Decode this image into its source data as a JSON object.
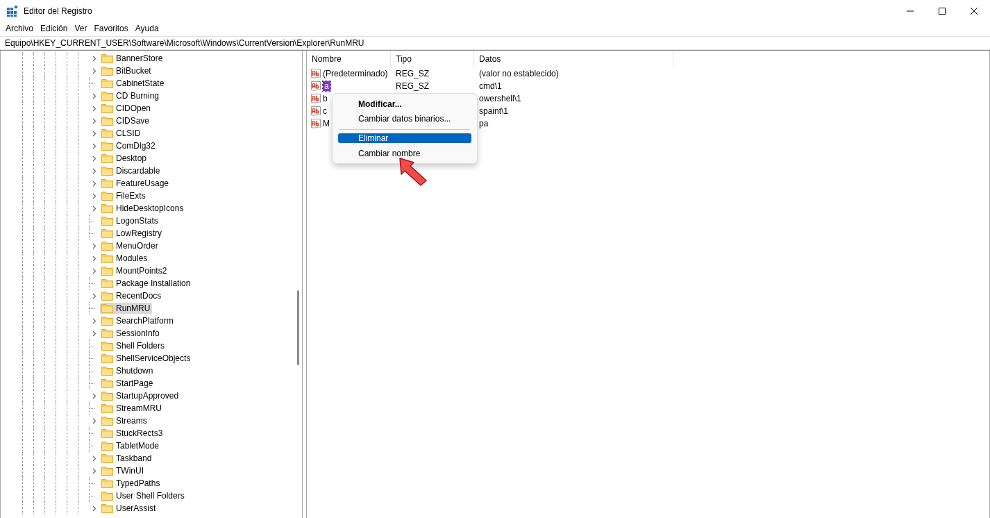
{
  "window": {
    "title": "Editor del Registro"
  },
  "menu": [
    "Archivo",
    "Edición",
    "Ver",
    "Favoritos",
    "Ayuda"
  ],
  "address": "Equipo\\HKEY_CURRENT_USER\\Software\\Microsoft\\Windows\\CurrentVersion\\Explorer\\RunMRU",
  "tree": [
    {
      "label": "BannerStore",
      "expandable": true,
      "selected": false
    },
    {
      "label": "BitBucket",
      "expandable": true,
      "selected": false
    },
    {
      "label": "CabinetState",
      "expandable": false,
      "selected": false
    },
    {
      "label": "CD Burning",
      "expandable": true,
      "selected": false
    },
    {
      "label": "CIDOpen",
      "expandable": true,
      "selected": false
    },
    {
      "label": "CIDSave",
      "expandable": true,
      "selected": false
    },
    {
      "label": "CLSID",
      "expandable": true,
      "selected": false
    },
    {
      "label": "ComDlg32",
      "expandable": true,
      "selected": false
    },
    {
      "label": "Desktop",
      "expandable": true,
      "selected": false
    },
    {
      "label": "Discardable",
      "expandable": true,
      "selected": false
    },
    {
      "label": "FeatureUsage",
      "expandable": true,
      "selected": false
    },
    {
      "label": "FileExts",
      "expandable": true,
      "selected": false
    },
    {
      "label": "HideDesktopIcons",
      "expandable": true,
      "selected": false
    },
    {
      "label": "LogonStats",
      "expandable": false,
      "selected": false
    },
    {
      "label": "LowRegistry",
      "expandable": false,
      "selected": false
    },
    {
      "label": "MenuOrder",
      "expandable": true,
      "selected": false
    },
    {
      "label": "Modules",
      "expandable": true,
      "selected": false
    },
    {
      "label": "MountPoints2",
      "expandable": true,
      "selected": false
    },
    {
      "label": "Package Installation",
      "expandable": false,
      "selected": false
    },
    {
      "label": "RecentDocs",
      "expandable": true,
      "selected": false
    },
    {
      "label": "RunMRU",
      "expandable": false,
      "selected": true
    },
    {
      "label": "SearchPlatform",
      "expandable": true,
      "selected": false
    },
    {
      "label": "SessionInfo",
      "expandable": true,
      "selected": false
    },
    {
      "label": "Shell Folders",
      "expandable": false,
      "selected": false
    },
    {
      "label": "ShellServiceObjects",
      "expandable": false,
      "selected": false
    },
    {
      "label": "Shutdown",
      "expandable": false,
      "selected": false
    },
    {
      "label": "StartPage",
      "expandable": false,
      "selected": false
    },
    {
      "label": "StartupApproved",
      "expandable": true,
      "selected": false
    },
    {
      "label": "StreamMRU",
      "expandable": false,
      "selected": false
    },
    {
      "label": "Streams",
      "expandable": true,
      "selected": false
    },
    {
      "label": "StuckRects3",
      "expandable": false,
      "selected": false
    },
    {
      "label": "TabletMode",
      "expandable": false,
      "selected": false
    },
    {
      "label": "Taskband",
      "expandable": true,
      "selected": false
    },
    {
      "label": "TWinUI",
      "expandable": true,
      "selected": false
    },
    {
      "label": "TypedPaths",
      "expandable": false,
      "selected": false
    },
    {
      "label": "User Shell Folders",
      "expandable": false,
      "selected": false
    },
    {
      "label": "UserAssist",
      "expandable": true,
      "selected": false
    }
  ],
  "values": {
    "columns": [
      "Nombre",
      "Tipo",
      "Datos"
    ],
    "rows": [
      {
        "name": "(Predeterminado)",
        "type": "REG_SZ",
        "data": "(valor no establecido)",
        "selected": false
      },
      {
        "name": "a",
        "type": "REG_SZ",
        "data": "cmd\\1",
        "selected": true
      },
      {
        "name": "b",
        "type": "",
        "data": "owershell\\1",
        "selected": false
      },
      {
        "name": "c",
        "type": "",
        "data": "spaint\\1",
        "selected": false
      },
      {
        "name": "M",
        "type": "",
        "data": "pa",
        "selected": false
      }
    ]
  },
  "context_menu": [
    {
      "kind": "item",
      "label": "Modificar...",
      "default": true,
      "selected": false
    },
    {
      "kind": "item",
      "label": "Cambiar datos binarios...",
      "default": false,
      "selected": false
    },
    {
      "kind": "separator"
    },
    {
      "kind": "item",
      "label": "Eliminar",
      "default": false,
      "selected": true
    },
    {
      "kind": "item",
      "label": "Cambiar nombre",
      "default": false,
      "selected": false
    }
  ]
}
